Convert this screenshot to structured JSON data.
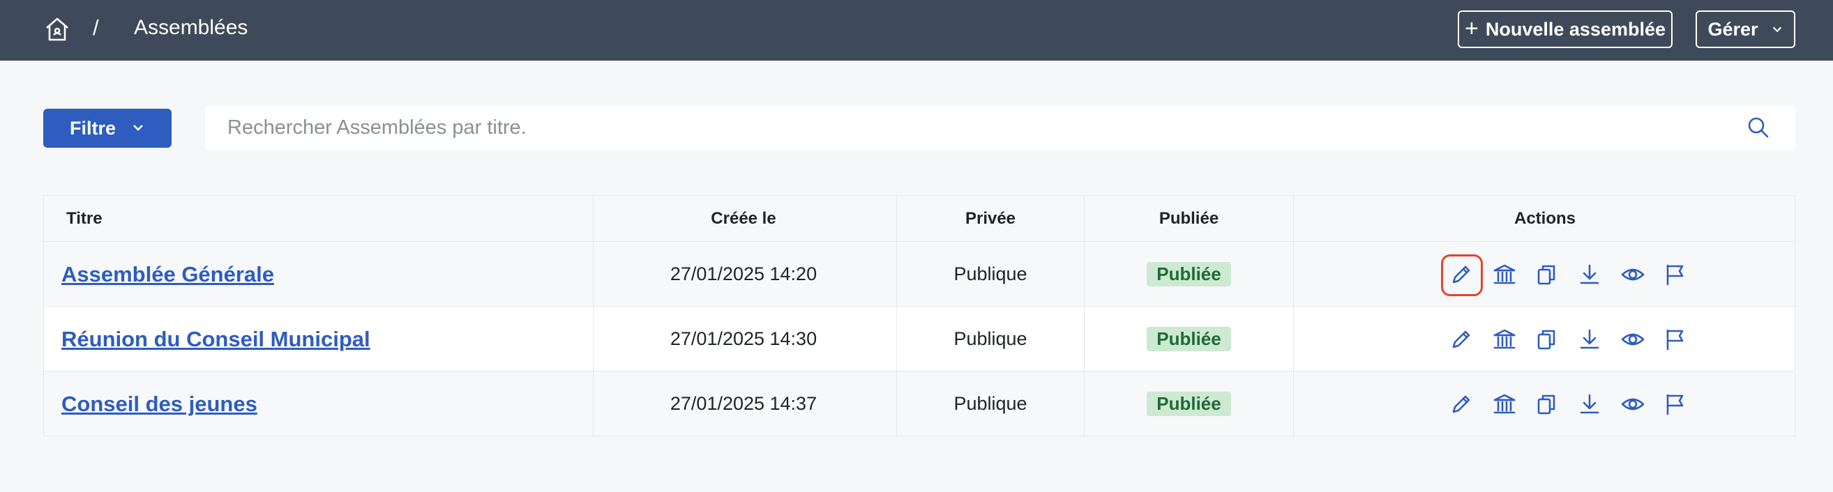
{
  "topbar": {
    "breadcrumb_sep": "/",
    "breadcrumb_current": "Assemblées",
    "new_button_label": "Nouvelle assemblée",
    "manage_button_label": "Gérer"
  },
  "filter": {
    "button_label": "Filtre"
  },
  "search": {
    "placeholder": "Rechercher Assemblées par titre.",
    "value": ""
  },
  "table": {
    "columns": [
      "Titre",
      "Créée le",
      "Privée",
      "Publiée",
      "Actions"
    ],
    "rows": [
      {
        "title": "Assemblée Générale",
        "created": "27/01/2025 14:20",
        "private": "Publique",
        "published": "Publiée"
      },
      {
        "title": "Réunion du Conseil Municipal",
        "created": "27/01/2025 14:30",
        "private": "Publique",
        "published": "Publiée"
      },
      {
        "title": "Conseil des jeunes",
        "created": "27/01/2025 14:37",
        "private": "Publique",
        "published": "Publiée"
      }
    ],
    "action_icons": [
      "pencil-icon",
      "building-icon",
      "copy-icon",
      "download-icon",
      "eye-icon",
      "flag-icon"
    ]
  },
  "colors": {
    "topbar_bg": "#3e4a5a",
    "accent": "#2e5cbf",
    "badge_bg": "#cde9d2",
    "badge_text": "#1f6b34",
    "highlight": "#e2452d",
    "page_bg": "#f6f7f9"
  }
}
